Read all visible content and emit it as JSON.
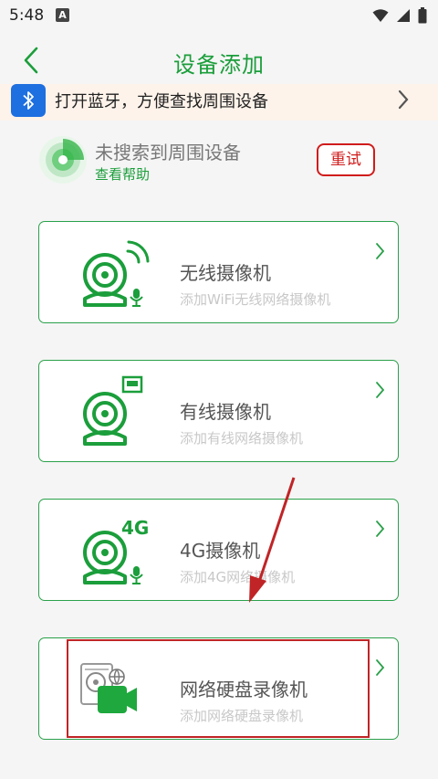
{
  "status": {
    "time": "5:48",
    "notif_letter": "A"
  },
  "header": {
    "title": "设备添加"
  },
  "bluetooth": {
    "text": "打开蓝牙，方便查找周围设备"
  },
  "search": {
    "title": "未搜索到周围设备",
    "help": "查看帮助",
    "retry": "重试"
  },
  "cards": [
    {
      "title": "无线摄像机",
      "subtitle": "添加WiFi无线网络摄像机"
    },
    {
      "title": "有线摄像机",
      "subtitle": "添加有线网络摄像机"
    },
    {
      "title": "4G摄像机",
      "subtitle": "添加4G网络摄像机",
      "badge": "4G"
    },
    {
      "title": "网络硬盘录像机",
      "subtitle": "添加网络硬盘录像机"
    }
  ],
  "colors": {
    "accent": "#1b9e3b",
    "retry": "#d01c1c",
    "banner": "#fdf3ea",
    "bluetooth": "#1e6fe0",
    "annotation": "#c02426"
  },
  "icons": [
    "back-icon",
    "bluetooth-icon",
    "radar-icon",
    "chevron-right-icon",
    "wifi-camera-icon",
    "wired-camera-icon",
    "4g-camera-icon",
    "nvr-icon",
    "wifi-status-icon",
    "signal-status-icon",
    "battery-status-icon"
  ]
}
